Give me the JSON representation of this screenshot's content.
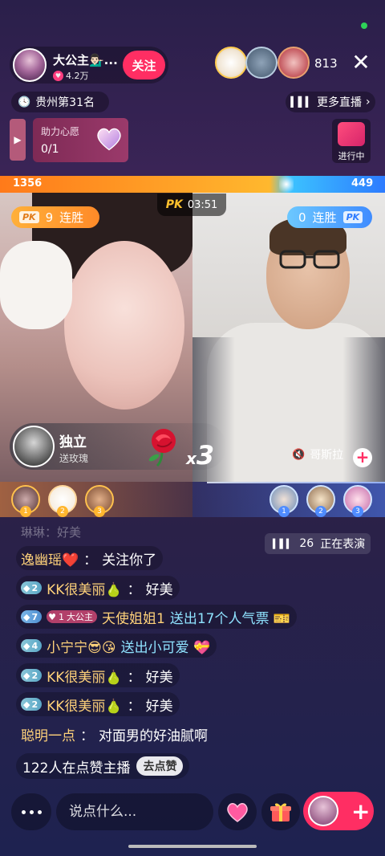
{
  "host": {
    "name": "大公主💁🏻‍♂️...",
    "fans": "4.2万",
    "follow_label": "关注"
  },
  "viewers": {
    "count": "813"
  },
  "close_label": "✕",
  "rank": {
    "label": "贵州第31名"
  },
  "more_live": {
    "label": "更多直播"
  },
  "wish": {
    "title": "助力心愿",
    "value": "0/1"
  },
  "in_progress": {
    "label": "进行中"
  },
  "pk": {
    "score_left": "1356",
    "score_right": "449",
    "logo": "PK",
    "timer": "03:51",
    "left_streak_num": "9",
    "right_streak_num": "0",
    "streak_label": "连胜"
  },
  "gift": {
    "sender": "独立",
    "desc": "送玫瑰",
    "multiplier_x": "x",
    "multiplier_num": "3"
  },
  "right_host": {
    "name": "哥斯拉"
  },
  "left_ranks": [
    "1",
    "2",
    "3"
  ],
  "right_ranks": [
    "1",
    "2",
    "3"
  ],
  "perform": {
    "count": "26",
    "label": "正在表演"
  },
  "chat": {
    "faded": "琳琳：好美",
    "lines": [
      {
        "user": "逸幽瑶❤️",
        "sep": "：",
        "text": "关注你了"
      },
      {
        "level": "2",
        "user": "KK很美丽🍐",
        "sep": "：",
        "text": "好美"
      },
      {
        "level": "7",
        "fan_level": "1",
        "fan_name": "大公主",
        "user": "天使姐姐1",
        "text": "送出17个人气票 🎫"
      },
      {
        "level": "4",
        "user": "小宁宁😎😘",
        "text": "送出小可爱 💝"
      },
      {
        "level": "2",
        "user": "KK很美丽🍐",
        "sep": "：",
        "text": "好美"
      },
      {
        "level": "2",
        "user": "KK很美丽🍐",
        "sep": "：",
        "text": "好美"
      },
      {
        "user": "聪明一点",
        "sep": "：",
        "text": "对面男的好油腻啊"
      }
    ]
  },
  "likes": {
    "text": "122人在点赞主播",
    "button": "去点赞"
  },
  "input": {
    "placeholder": "说点什么..."
  },
  "colors": {
    "accent": "#ff2e63",
    "pk_left": "#ff8a28",
    "pk_right": "#3f8cff"
  }
}
